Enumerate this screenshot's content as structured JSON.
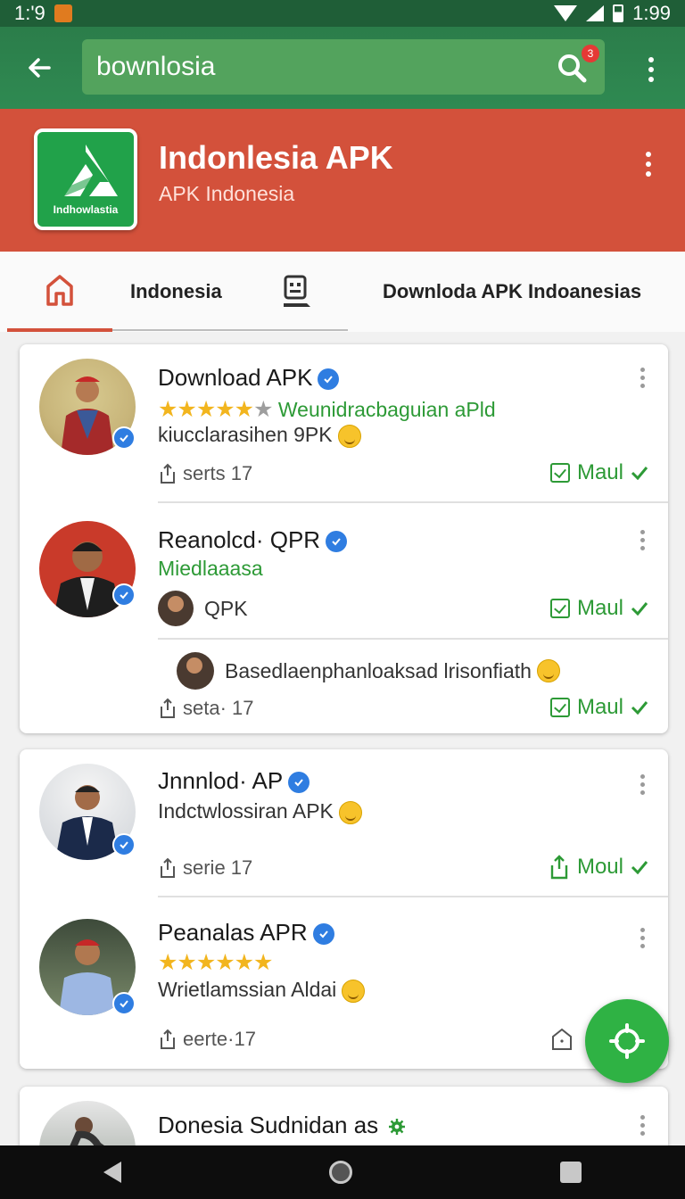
{
  "status_bar": {
    "time_left": "1:'9",
    "time_right": "1:99"
  },
  "search": {
    "value": "bownlosia",
    "badge": "3"
  },
  "app": {
    "title": "Indonlesia APK",
    "subtitle": "APK Indonesia",
    "logo_text": "Indhowlastia"
  },
  "tabs": {
    "label1": "Indonesia",
    "label2": "Downloda APK  Indoanesias"
  },
  "cards": [
    {
      "items": [
        {
          "title": "Download APK",
          "rating_text": "Weunidracbaguian aPld",
          "line2": "kiucclarasihen 9PK",
          "meta": "serts 17",
          "action": "Maul"
        },
        {
          "title": "Reanolcd· QPR",
          "line1": "Miedlaaasa",
          "line2": "QPK",
          "action": "Maul"
        },
        {
          "line1": "Basedlaenphanloaksad lrisonfiath",
          "meta": "seta· 17",
          "action": "Maul"
        }
      ]
    },
    {
      "items": [
        {
          "title": "Jnnnlod· AP",
          "line1": "Indctwlossiran APK",
          "meta": "serie 17",
          "action": "Moul"
        },
        {
          "title": "Peanalas APR",
          "line1": "Wrietlamssian Aldai",
          "meta": "eerte·17"
        }
      ]
    },
    {
      "items": [
        {
          "title": "Donesia Sudnidan as"
        }
      ]
    }
  ],
  "colors": {
    "toolbar": "#2b7d4a",
    "banner": "#d3513b",
    "accent_green": "#2d9a36",
    "fab": "#2fb244",
    "verified": "#2f7de1"
  }
}
